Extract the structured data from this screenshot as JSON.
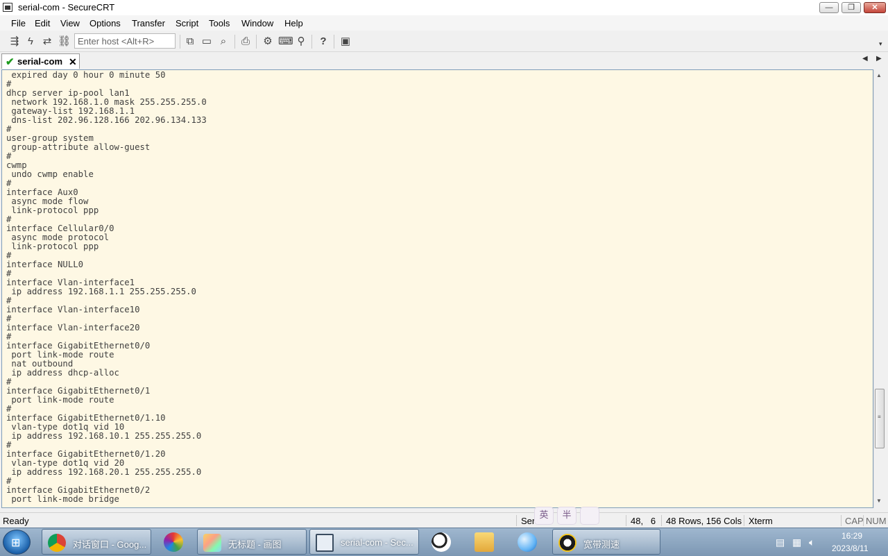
{
  "window": {
    "title": "serial-com - SecureCRT",
    "icon": "securecrt-app-icon",
    "controls": {
      "minimize": "—",
      "maximize": "❐",
      "close": "✕"
    }
  },
  "menu": [
    "File",
    "Edit",
    "View",
    "Options",
    "Transfer",
    "Script",
    "Tools",
    "Window",
    "Help"
  ],
  "toolbar": {
    "icons": [
      "connect-icon",
      "quick-connect-icon",
      "reconnect-icon",
      "disconnect-icon",
      "copy-icon",
      "paste-icon",
      "find-icon",
      "print-icon",
      "session-options-icon",
      "keymap-icon",
      "sftp-icon",
      "help-icon",
      "screenshot-icon"
    ],
    "host_placeholder": "Enter host <Alt+R>",
    "overflow": "▾"
  },
  "tabs": [
    {
      "label": "serial-com",
      "status": "connected",
      "close": "✕"
    }
  ],
  "tab_nav": {
    "prev": "◀",
    "next": "▶"
  },
  "terminal": {
    "background": "#fef8e4",
    "lines": [
      " expired day 0 hour 0 minute 50",
      "#",
      "dhcp server ip-pool lan1",
      " network 192.168.1.0 mask 255.255.255.0",
      " gateway-list 192.168.1.1",
      " dns-list 202.96.128.166 202.96.134.133",
      "#",
      "user-group system",
      " group-attribute allow-guest",
      "#",
      "cwmp",
      " undo cwmp enable",
      "#",
      "interface Aux0",
      " async mode flow",
      " link-protocol ppp",
      "#",
      "interface Cellular0/0",
      " async mode protocol",
      " link-protocol ppp",
      "#",
      "interface NULL0",
      "#",
      "interface Vlan-interface1",
      " ip address 192.168.1.1 255.255.255.0",
      "#",
      "interface Vlan-interface10",
      "#",
      "interface Vlan-interface20",
      "#",
      "interface GigabitEthernet0/0",
      " port link-mode route",
      " nat outbound",
      " ip address dhcp-alloc",
      "#",
      "interface GigabitEthernet0/1",
      " port link-mode route",
      "#",
      "interface GigabitEthernet0/1.10",
      " vlan-type dot1q vid 10",
      " ip address 192.168.10.1 255.255.255.0",
      "#",
      "interface GigabitEthernet0/1.20",
      " vlan-type dot1q vid 20",
      " ip address 192.168.20.1 255.255.255.0",
      "#",
      "interface GigabitEthernet0/2",
      " port link-mode bridge"
    ]
  },
  "scrollbar": {
    "up": "▲",
    "down": "▼",
    "grip": "≡"
  },
  "status": {
    "ready": "Ready",
    "session": "Ser",
    "cursor": "48,   6",
    "size": "48 Rows, 156 Cols",
    "emulation": "Xterm",
    "cap": "CAP",
    "num": "NUM"
  },
  "ime": {
    "lang": "英",
    "width": "半",
    "extra": ""
  },
  "taskbar": {
    "start_icon": "windows-start-icon",
    "items": [
      {
        "label": "对话窗口 - Goog...",
        "icon": "chrome-icon"
      },
      {
        "label": "",
        "icon": "pinwheel-app-icon"
      },
      {
        "label": "无标题 - 画图",
        "icon": "paint-icon"
      },
      {
        "label": "serial-com - Sec...",
        "icon": "securecrt-icon",
        "active": true
      },
      {
        "label": "",
        "icon": "soccer-ball-icon"
      },
      {
        "label": "",
        "icon": "file-explorer-icon"
      },
      {
        "label": "",
        "icon": "globe-app-icon"
      },
      {
        "label": "宽带测速",
        "icon": "speedometer-icon"
      }
    ]
  },
  "tray": {
    "icons": [
      "tray-device-icon",
      "tray-network-icon",
      "tray-volume-icon"
    ],
    "time": "16:29",
    "date": "2023/8/11"
  }
}
